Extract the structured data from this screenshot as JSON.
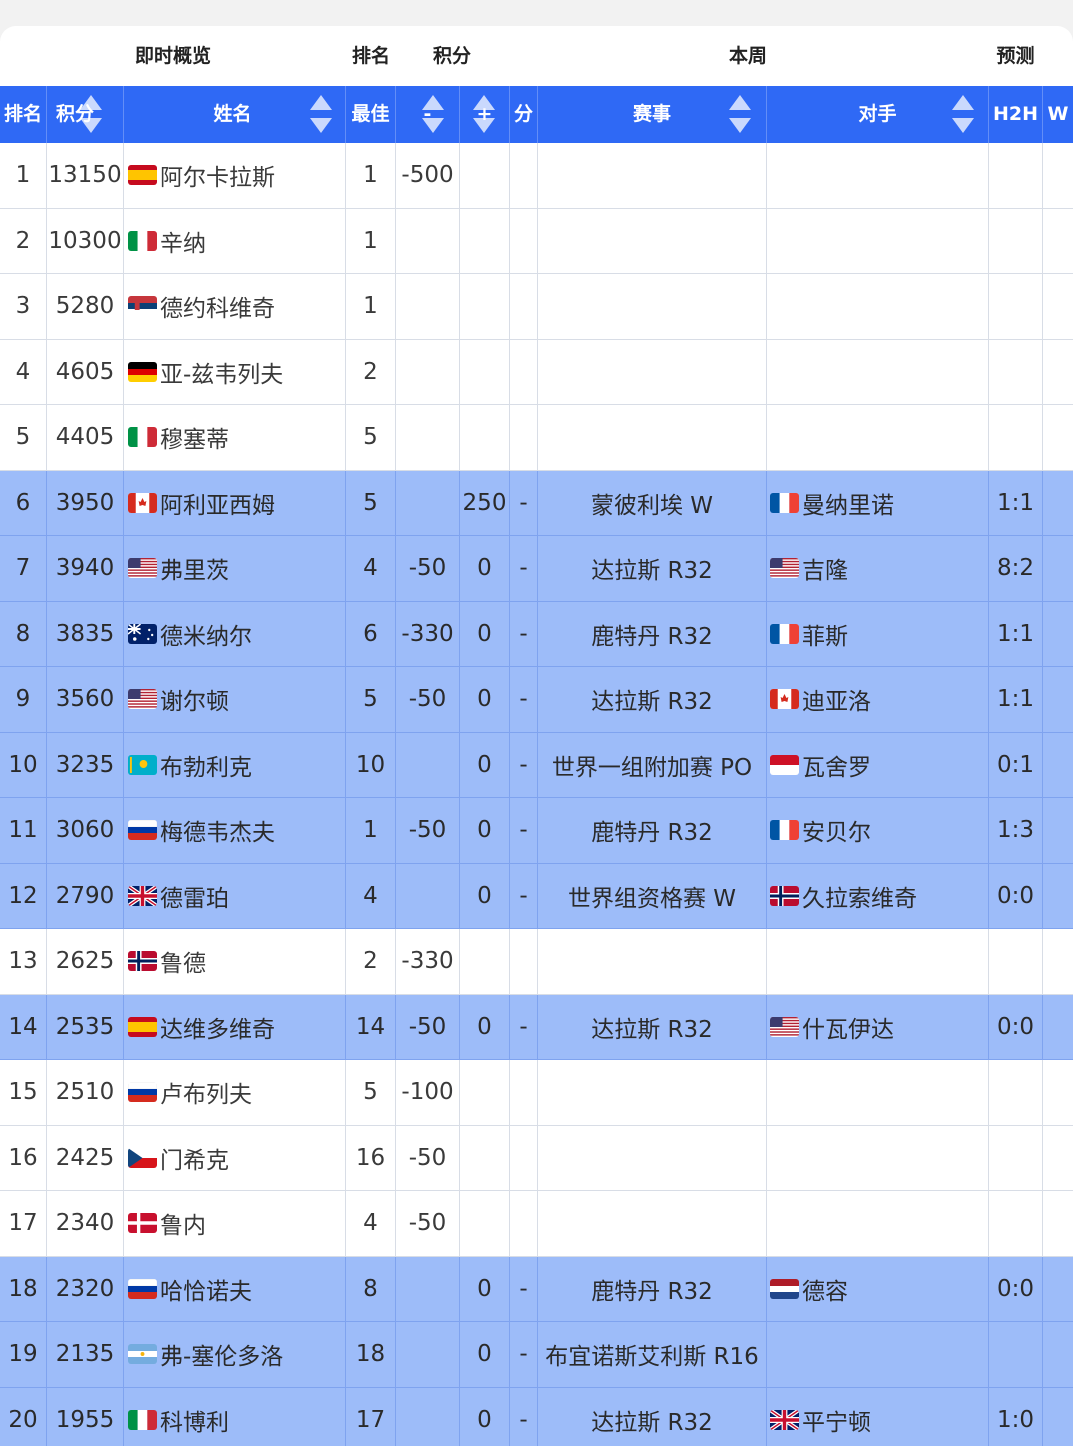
{
  "group_headers": {
    "live": "即时概览",
    "rank": "排名",
    "points": "积分",
    "this_week": "本周",
    "forecast": "预测"
  },
  "columns": {
    "rank": "排名",
    "points": "积分",
    "name": "姓名",
    "best": "最佳",
    "minus": "-",
    "plus": "+",
    "fen": "分",
    "event": "赛事",
    "opponent": "对手",
    "h2h": "H2H",
    "w": "W"
  },
  "flag_colors": {
    "spain": [
      "#c60b1e",
      "#ffc400"
    ],
    "italy": [
      "#009246",
      "#ffffff",
      "#ce2b37"
    ],
    "serbia": [
      "#c6363c",
      "#0c4076",
      "#ffffff"
    ],
    "germany": [
      "#000000",
      "#dd0000",
      "#ffce00"
    ],
    "canada": [
      "#d52b1e",
      "#ffffff"
    ],
    "france": [
      "#0055a4",
      "#ffffff",
      "#ef4135"
    ],
    "usa": [
      "#b22234",
      "#ffffff",
      "#3c3b6e"
    ],
    "australia": [
      "#012169",
      "#ffffff"
    ],
    "kazakhstan": [
      "#00afca",
      "#fec50c"
    ],
    "russia": [
      "#ffffff",
      "#0039a6",
      "#d52b1e"
    ],
    "uk": [
      "#012169",
      "#ffffff",
      "#c8102e"
    ],
    "norway": [
      "#ba0c2f",
      "#ffffff",
      "#00205b"
    ],
    "czech": [
      "#ffffff",
      "#d7141a",
      "#11457e"
    ],
    "denmark": [
      "#c8102e",
      "#ffffff"
    ],
    "argentina": [
      "#74acdf",
      "#ffffff",
      "#f6b40e"
    ],
    "indonesia": [
      "#ce1126",
      "#ffffff"
    ],
    "netherlands": [
      "#ae1c28",
      "#ffffff",
      "#21468b"
    ]
  },
  "rows": [
    {
      "rank": "1",
      "points": "13150",
      "flag": "spain-flag",
      "name": "阿尔卡拉斯",
      "best": "1",
      "minus": "-500",
      "plus": "",
      "fen": "",
      "event": "",
      "opp_flag": "",
      "opponent": "",
      "h2h": "",
      "hl": false
    },
    {
      "rank": "2",
      "points": "10300",
      "flag": "italy-flag",
      "name": "辛纳",
      "best": "1",
      "minus": "",
      "plus": "",
      "fen": "",
      "event": "",
      "opp_flag": "",
      "opponent": "",
      "h2h": "",
      "hl": false
    },
    {
      "rank": "3",
      "points": "5280",
      "flag": "serbia-flag",
      "name": "德约科维奇",
      "best": "1",
      "minus": "",
      "plus": "",
      "fen": "",
      "event": "",
      "opp_flag": "",
      "opponent": "",
      "h2h": "",
      "hl": false
    },
    {
      "rank": "4",
      "points": "4605",
      "flag": "germany-flag",
      "name": "亚-兹韦列夫",
      "best": "2",
      "minus": "",
      "plus": "",
      "fen": "",
      "event": "",
      "opp_flag": "",
      "opponent": "",
      "h2h": "",
      "hl": false
    },
    {
      "rank": "5",
      "points": "4405",
      "flag": "italy-flag",
      "name": "穆塞蒂",
      "best": "5",
      "minus": "",
      "plus": "",
      "fen": "",
      "event": "",
      "opp_flag": "",
      "opponent": "",
      "h2h": "",
      "hl": false
    },
    {
      "rank": "6",
      "points": "3950",
      "flag": "canada-flag",
      "name": "阿利亚西姆",
      "best": "5",
      "minus": "",
      "plus": "250",
      "fen": "-",
      "event": "蒙彼利埃 W",
      "opp_flag": "france-flag",
      "opponent": "曼纳里诺",
      "h2h": "1:1",
      "hl": true
    },
    {
      "rank": "7",
      "points": "3940",
      "flag": "usa-flag",
      "name": "弗里茨",
      "best": "4",
      "minus": "-50",
      "plus": "0",
      "fen": "-",
      "event": "达拉斯 R32",
      "opp_flag": "usa-flag",
      "opponent": "吉隆",
      "h2h": "8:2",
      "hl": true
    },
    {
      "rank": "8",
      "points": "3835",
      "flag": "australia-flag",
      "name": "德米纳尔",
      "best": "6",
      "minus": "-330",
      "plus": "0",
      "fen": "-",
      "event": "鹿特丹 R32",
      "opp_flag": "france-flag",
      "opponent": "菲斯",
      "h2h": "1:1",
      "hl": true
    },
    {
      "rank": "9",
      "points": "3560",
      "flag": "usa-flag",
      "name": "谢尔顿",
      "best": "5",
      "minus": "-50",
      "plus": "0",
      "fen": "-",
      "event": "达拉斯 R32",
      "opp_flag": "canada-flag",
      "opponent": "迪亚洛",
      "h2h": "1:1",
      "hl": true
    },
    {
      "rank": "10",
      "points": "3235",
      "flag": "kazakhstan-flag",
      "name": "布勃利克",
      "best": "10",
      "minus": "",
      "plus": "0",
      "fen": "-",
      "event": "世界一组附加赛 PO",
      "opp_flag": "indonesia-flag",
      "opponent": "瓦舍罗",
      "h2h": "0:1",
      "hl": true
    },
    {
      "rank": "11",
      "points": "3060",
      "flag": "russia-flag",
      "name": "梅德韦杰夫",
      "best": "1",
      "minus": "-50",
      "plus": "0",
      "fen": "-",
      "event": "鹿特丹 R32",
      "opp_flag": "france-flag",
      "opponent": "安贝尔",
      "h2h": "1:3",
      "hl": true
    },
    {
      "rank": "12",
      "points": "2790",
      "flag": "uk-flag",
      "name": "德雷珀",
      "best": "4",
      "minus": "",
      "plus": "0",
      "fen": "-",
      "event": "世界组资格赛 W",
      "opp_flag": "norway-flag",
      "opponent": "久拉索维奇",
      "h2h": "0:0",
      "hl": true
    },
    {
      "rank": "13",
      "points": "2625",
      "flag": "norway-flag",
      "name": "鲁德",
      "best": "2",
      "minus": "-330",
      "plus": "",
      "fen": "",
      "event": "",
      "opp_flag": "",
      "opponent": "",
      "h2h": "",
      "hl": false
    },
    {
      "rank": "14",
      "points": "2535",
      "flag": "spain-flag",
      "name": "达维多维奇",
      "best": "14",
      "minus": "-50",
      "plus": "0",
      "fen": "-",
      "event": "达拉斯 R32",
      "opp_flag": "usa-flag",
      "opponent": "什瓦伊达",
      "h2h": "0:0",
      "hl": true
    },
    {
      "rank": "15",
      "points": "2510",
      "flag": "russia-flag",
      "name": "卢布列夫",
      "best": "5",
      "minus": "-100",
      "plus": "",
      "fen": "",
      "event": "",
      "opp_flag": "",
      "opponent": "",
      "h2h": "",
      "hl": false
    },
    {
      "rank": "16",
      "points": "2425",
      "flag": "czech-flag",
      "name": "门希克",
      "best": "16",
      "minus": "-50",
      "plus": "",
      "fen": "",
      "event": "",
      "opp_flag": "",
      "opponent": "",
      "h2h": "",
      "hl": false
    },
    {
      "rank": "17",
      "points": "2340",
      "flag": "denmark-flag",
      "name": "鲁内",
      "best": "4",
      "minus": "-50",
      "plus": "",
      "fen": "",
      "event": "",
      "opp_flag": "",
      "opponent": "",
      "h2h": "",
      "hl": false
    },
    {
      "rank": "18",
      "points": "2320",
      "flag": "russia-flag",
      "name": "哈恰诺夫",
      "best": "8",
      "minus": "",
      "plus": "0",
      "fen": "-",
      "event": "鹿特丹 R32",
      "opp_flag": "netherlands-flag",
      "opponent": "德容",
      "h2h": "0:0",
      "hl": true
    },
    {
      "rank": "19",
      "points": "2135",
      "flag": "argentina-flag",
      "name": "弗-塞伦多洛",
      "best": "18",
      "minus": "",
      "plus": "0",
      "fen": "-",
      "event": "布宜诺斯艾利斯 R16",
      "opp_flag": "",
      "opponent": "",
      "h2h": "",
      "hl": true
    },
    {
      "rank": "20",
      "points": "1955",
      "flag": "italy-flag",
      "name": "科博利",
      "best": "17",
      "minus": "",
      "plus": "0",
      "fen": "-",
      "event": "达拉斯 R32",
      "opp_flag": "uk-flag",
      "opponent": "平宁顿",
      "h2h": "1:0",
      "hl": true
    }
  ]
}
